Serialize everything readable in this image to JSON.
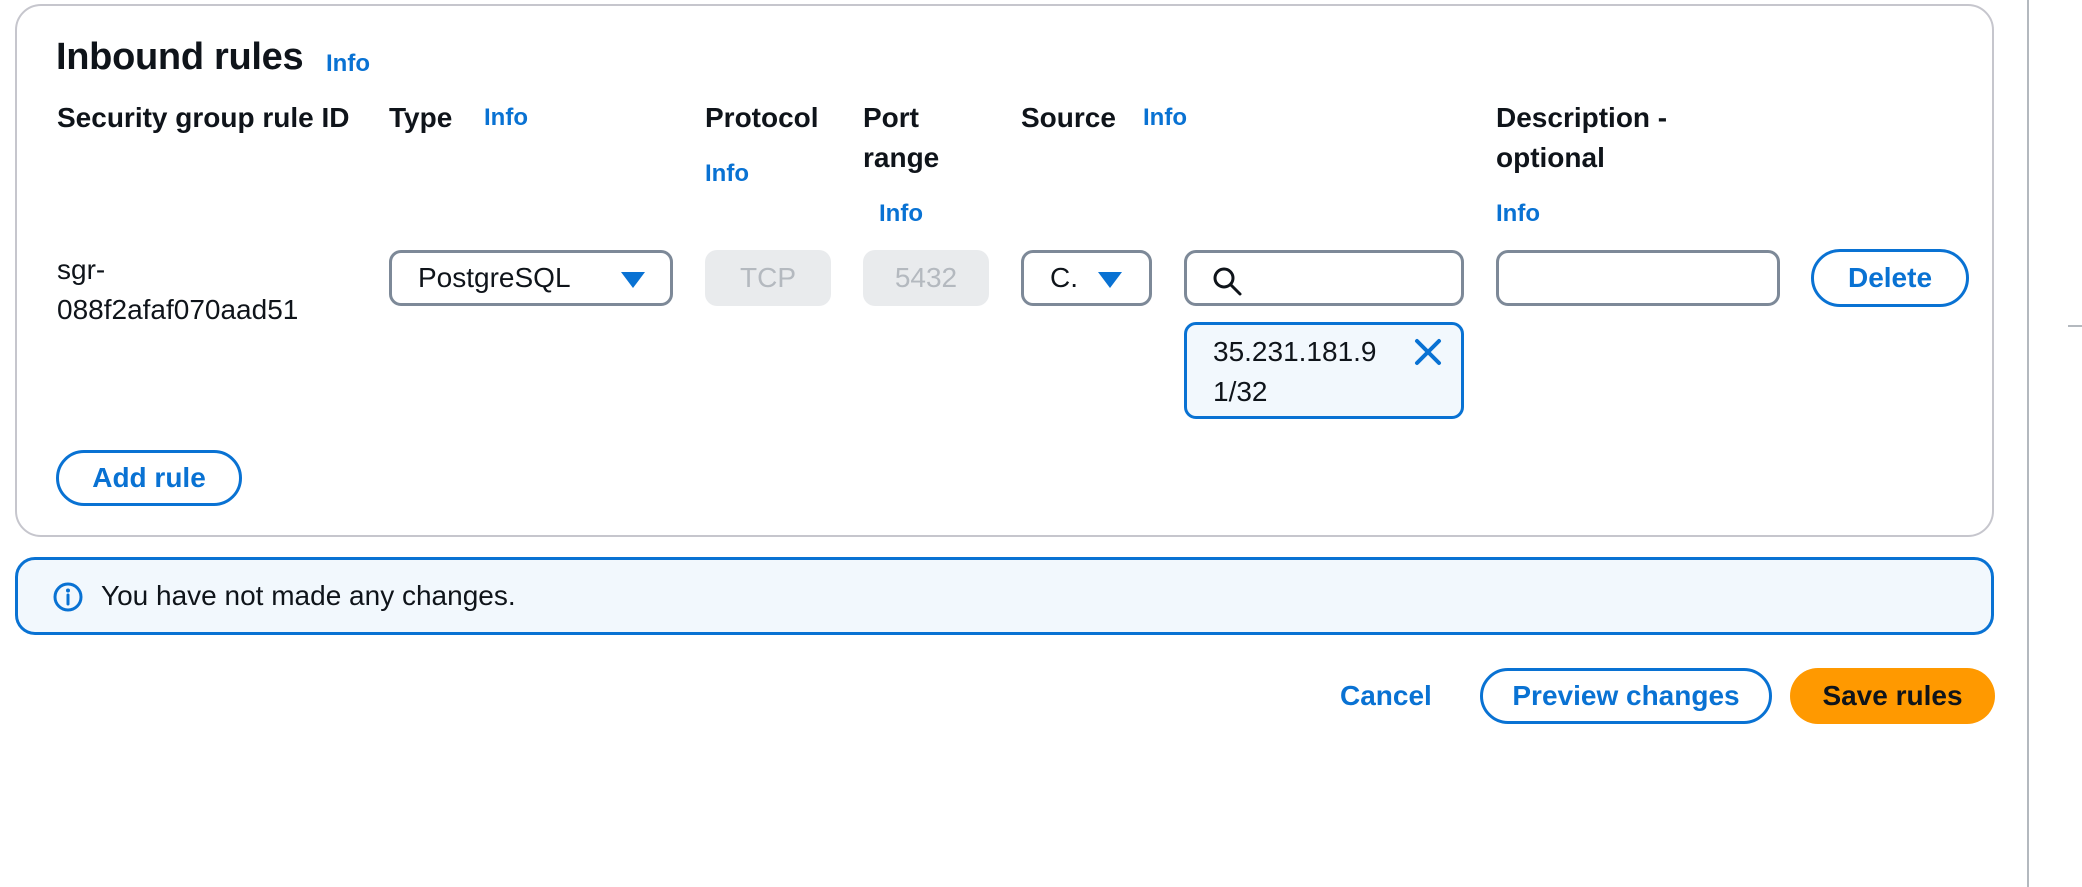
{
  "section": {
    "title": "Inbound rules",
    "info_label": "Info"
  },
  "columns": {
    "rule_id": "Security group rule ID",
    "type": "Type",
    "type_info": "Info",
    "protocol": "Protocol",
    "protocol_info": "Info",
    "port_range_line1": "Port",
    "port_range_line2": "range",
    "port_range_info": "Info",
    "source": "Source",
    "source_info": "Info",
    "description_line1": "Description -",
    "description_line2": "optional",
    "description_info": "Info"
  },
  "rule": {
    "id_line1": "sgr-",
    "id_line2": "088f2afaf070aad51",
    "type_value": "PostgreSQL",
    "protocol_value": "TCP",
    "port_value": "5432",
    "source_type_value": "C.",
    "source_search_value": "",
    "source_token_line1": "35.231.181.9",
    "source_token_line2": "1/32",
    "description_value": "",
    "delete_label": "Delete"
  },
  "add_rule_label": "Add rule",
  "alert": {
    "message": "You have not made any changes."
  },
  "footer": {
    "cancel_label": "Cancel",
    "preview_label": "Preview changes",
    "save_label": "Save rules"
  },
  "colors": {
    "accent": "#0972d3",
    "primary_button": "#ff9900",
    "info_bg": "#f2f8fd"
  }
}
